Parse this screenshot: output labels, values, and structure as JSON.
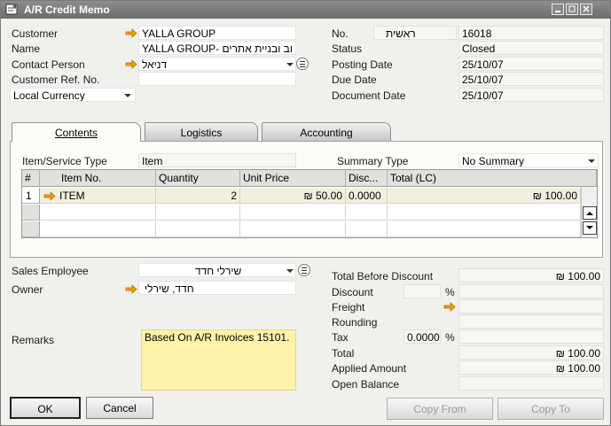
{
  "window": {
    "title": "A/R Credit Memo"
  },
  "header_left": {
    "customer_label": "Customer",
    "customer_value": "YALLA GROUP",
    "name_label": "Name",
    "name_value": "YALLA GROUP- וב ובניית אתרים",
    "contact_label": "Contact Person",
    "contact_value": "דניאל",
    "ref_label": "Customer Ref. No.",
    "ref_value": "",
    "currency_value": "Local Currency"
  },
  "header_right": {
    "no_label": "No.",
    "series_value": "ראשית",
    "no_value": "16018",
    "status_label": "Status",
    "status_value": "Closed",
    "posting_label": "Posting Date",
    "posting_value": "25/10/07",
    "due_label": "Due Date",
    "due_value": "25/10/07",
    "document_label": "Document Date",
    "document_value": "25/10/07"
  },
  "tabs": [
    {
      "label": "Contents",
      "active": true
    },
    {
      "label": "Logistics",
      "active": false
    },
    {
      "label": "Accounting",
      "active": false
    }
  ],
  "contents": {
    "item_type_label": "Item/Service Type",
    "item_type_value": "Item",
    "summary_label": "Summary Type",
    "summary_value": "No Summary",
    "columns": [
      "#",
      "Item No.",
      "Quantity",
      "Unit Price",
      "Disc...",
      "Total (LC)"
    ],
    "rows": [
      {
        "num": "1",
        "item_no": "ITEM",
        "quantity": "2",
        "unit_price": "₪ 50.00",
        "discount": "0.0000",
        "total": "₪ 100.00"
      }
    ]
  },
  "footer_left": {
    "sales_employee_label": "Sales Employee",
    "sales_employee_value": "שירלי חדד",
    "owner_label": "Owner",
    "owner_value": "חדד, שירלי",
    "remarks_label": "Remarks",
    "remarks_value": "Based On A/R Invoices 15101."
  },
  "totals": {
    "before_discount_label": "Total Before Discount",
    "before_discount_value": "₪ 100.00",
    "discount_label": "Discount",
    "discount_pct_sign": "%",
    "freight_label": "Freight",
    "rounding_label": "Rounding",
    "tax_label": "Tax",
    "tax_rate": "0.0000",
    "tax_pct_sign": "%",
    "total_label": "Total",
    "total_value": "₪ 100.00",
    "applied_label": "Applied Amount",
    "applied_value": "₪ 100.00",
    "open_label": "Open Balance",
    "open_value": ""
  },
  "buttons": {
    "ok": "OK",
    "cancel": "Cancel",
    "copy_from": "Copy From",
    "copy_to": "Copy To"
  },
  "colors": {
    "link_arrow": "#f0a000",
    "remarks_bg": "#fff1a8",
    "titlebar": "#7a7a7a"
  }
}
